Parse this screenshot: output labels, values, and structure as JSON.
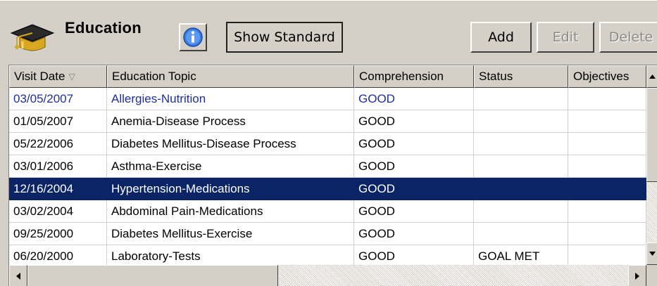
{
  "toolbar": {
    "title": "Education",
    "icon": "graduation-cap-icon",
    "info_icon": "info-icon",
    "show_standard_label": "Show Standard",
    "add_label": "Add",
    "edit_label": "Edit",
    "delete_label": "Delete"
  },
  "grid": {
    "columns": {
      "visit_date": "Visit Date",
      "topic": "Education Topic",
      "comprehension": "Comprehension",
      "status": "Status",
      "objectives": "Objectives"
    },
    "sort_indicator": "▽",
    "rows": [
      {
        "date": "03/05/2007",
        "topic": "Allergies-Nutrition",
        "comprehension": "GOOD",
        "status": "",
        "objectives": ""
      },
      {
        "date": "01/05/2007",
        "topic": "Anemia-Disease Process",
        "comprehension": "GOOD",
        "status": "",
        "objectives": ""
      },
      {
        "date": "05/22/2006",
        "topic": "Diabetes Mellitus-Disease Process",
        "comprehension": "GOOD",
        "status": "",
        "objectives": ""
      },
      {
        "date": "03/01/2006",
        "topic": "Asthma-Exercise",
        "comprehension": "GOOD",
        "status": "",
        "objectives": ""
      },
      {
        "date": "12/16/2004",
        "topic": "Hypertension-Medications",
        "comprehension": "GOOD",
        "status": "",
        "objectives": ""
      },
      {
        "date": "03/02/2004",
        "topic": "Abdominal Pain-Medications",
        "comprehension": "GOOD",
        "status": "",
        "objectives": ""
      },
      {
        "date": "09/25/2000",
        "topic": "Diabetes Mellitus-Exercise",
        "comprehension": "GOOD",
        "status": "",
        "objectives": ""
      },
      {
        "date": "06/20/2000",
        "topic": "Laboratory-Tests",
        "comprehension": "GOOD",
        "status": "GOAL MET",
        "objectives": ""
      }
    ],
    "selected_row_index": 4,
    "colors": {
      "selection": "#0a2466",
      "first_row_text": "#1f2f9a"
    }
  }
}
